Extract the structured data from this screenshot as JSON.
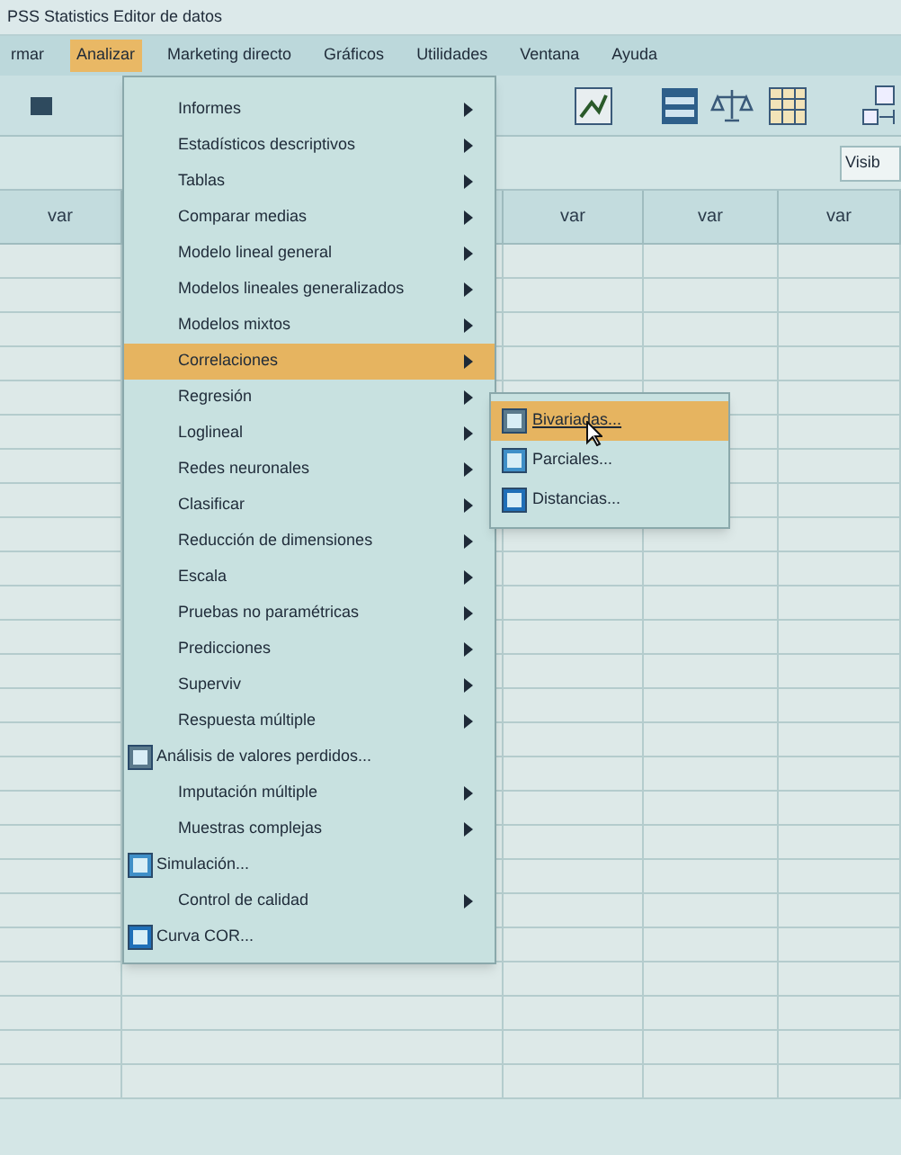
{
  "window": {
    "title": "PSS Statistics Editor de datos"
  },
  "menubar": [
    {
      "label": "rmar",
      "selected": false
    },
    {
      "label": "Analizar",
      "selected": true
    },
    {
      "label": "Marketing directo",
      "selected": false
    },
    {
      "label": "Gráficos",
      "selected": false
    },
    {
      "label": "Utilidades",
      "selected": false
    },
    {
      "label": "Ventana",
      "selected": false
    },
    {
      "label": "Ayuda",
      "selected": false
    }
  ],
  "visible_label": "Visib",
  "grid": {
    "columns": [
      "var",
      "var",
      "var",
      "var"
    ]
  },
  "analyze_menu": [
    {
      "label": "Informes",
      "kind": "submenu",
      "selected": false
    },
    {
      "label": "Estadísticos descriptivos",
      "kind": "submenu",
      "selected": false
    },
    {
      "label": "Tablas",
      "kind": "submenu",
      "selected": false
    },
    {
      "label": "Comparar medias",
      "kind": "submenu",
      "selected": false
    },
    {
      "label": "Modelo lineal general",
      "kind": "submenu",
      "selected": false
    },
    {
      "label": "Modelos lineales generalizados",
      "kind": "submenu",
      "selected": false
    },
    {
      "label": "Modelos mixtos",
      "kind": "submenu",
      "selected": false
    },
    {
      "label": "Correlaciones",
      "kind": "submenu",
      "selected": true
    },
    {
      "label": "Regresión",
      "kind": "submenu",
      "selected": false
    },
    {
      "label": "Loglineal",
      "kind": "submenu",
      "selected": false
    },
    {
      "label": "Redes neuronales",
      "kind": "submenu",
      "selected": false
    },
    {
      "label": "Clasificar",
      "kind": "submenu",
      "selected": false
    },
    {
      "label": "Reducción de dimensiones",
      "kind": "submenu",
      "selected": false
    },
    {
      "label": "Escala",
      "kind": "submenu",
      "selected": false
    },
    {
      "label": "Pruebas no paramétricas",
      "kind": "submenu",
      "selected": false
    },
    {
      "label": "Predicciones",
      "kind": "submenu",
      "selected": false
    },
    {
      "label": "Superviv",
      "kind": "submenu",
      "selected": false
    },
    {
      "label": "Respuesta múltiple",
      "kind": "submenu",
      "selected": false
    },
    {
      "label": "Análisis de valores perdidos...",
      "kind": "command",
      "selected": false
    },
    {
      "label": "Imputación múltiple",
      "kind": "submenu",
      "selected": false
    },
    {
      "label": "Muestras complejas",
      "kind": "submenu",
      "selected": false
    },
    {
      "label": "Simulación...",
      "kind": "command",
      "selected": false
    },
    {
      "label": "Control de calidad",
      "kind": "submenu",
      "selected": false
    },
    {
      "label": "Curva COR...",
      "kind": "command",
      "selected": false
    }
  ],
  "correlations_submenu": [
    {
      "label": "Bivariadas...",
      "selected": true
    },
    {
      "label": "Parciales...",
      "selected": false
    },
    {
      "label": "Distancias...",
      "selected": false
    }
  ]
}
